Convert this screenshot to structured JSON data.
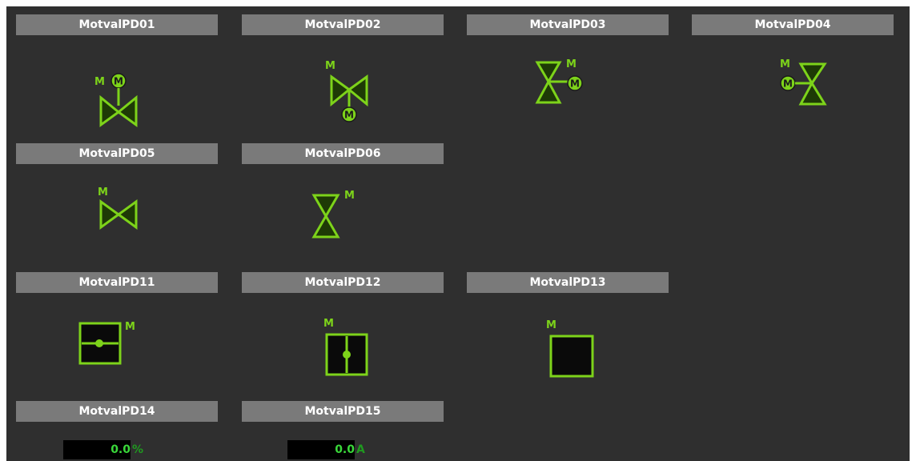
{
  "colors": {
    "background": "#2f2f2f",
    "label_bar": "#7a7a7a",
    "valve_green": "#7dd31a",
    "valve_fill_dark": "#1e3a06",
    "readout_text": "#3ad83a"
  },
  "devices": [
    {
      "label": "MotvalPD01",
      "symbol": "butterfly-valve-horizontal-motor-top",
      "motor_letter": "M",
      "actuator_glyph": "M"
    },
    {
      "label": "MotvalPD02",
      "symbol": "butterfly-valve-horizontal-motor-bottom",
      "motor_letter": "M",
      "actuator_glyph": "M"
    },
    {
      "label": "MotvalPD03",
      "symbol": "butterfly-valve-vertical-motor-right",
      "motor_letter": "M",
      "actuator_glyph": "M"
    },
    {
      "label": "MotvalPD04",
      "symbol": "butterfly-valve-vertical-motor-left",
      "motor_letter": "M",
      "actuator_glyph": "M"
    },
    {
      "label": "MotvalPD05",
      "symbol": "valve-horizontal",
      "motor_letter": "M"
    },
    {
      "label": "MotvalPD06",
      "symbol": "valve-vertical",
      "motor_letter": "M"
    },
    {
      "label": "MotvalPD11",
      "symbol": "damper-horizontal-stem",
      "motor_letter": "M"
    },
    {
      "label": "MotvalPD12",
      "symbol": "damper-vertical-stem",
      "motor_letter": "M"
    },
    {
      "label": "MotvalPD13",
      "symbol": "damper-closed",
      "motor_letter": "M"
    },
    {
      "label": "MotvalPD14",
      "symbol": "readout",
      "value": "0.0",
      "unit": "%"
    },
    {
      "label": "MotvalPD15",
      "symbol": "readout",
      "value": "0.0",
      "unit": "A"
    }
  ]
}
